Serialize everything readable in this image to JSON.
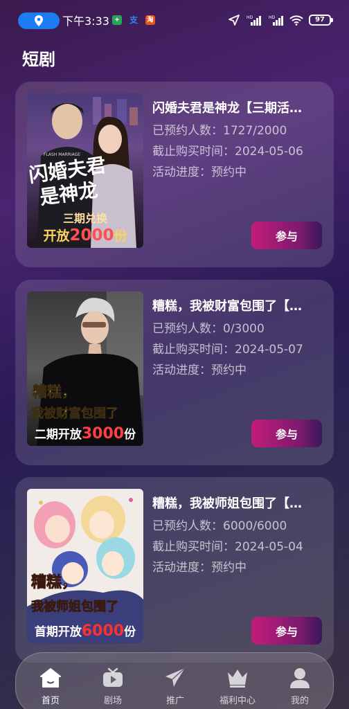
{
  "status_bar": {
    "time": "下午3:33",
    "app_icons": [
      "+",
      "支",
      "淘"
    ],
    "battery": "97",
    "network_labels": [
      "HD",
      "HD"
    ]
  },
  "page": {
    "title": "短剧"
  },
  "cards": [
    {
      "title": "闪婚夫君是神龙【三期活…",
      "reserved": "已预约人数：1727/2000",
      "deadline": "截止购买时间：2024-05-06",
      "progress": "活动进度：预约中",
      "button": "参与",
      "cover": {
        "title_line1": "闪婚夫君",
        "title_line2": "是神龙",
        "line1": "三期兑换",
        "line2_prefix": "开放",
        "line2_num": "2000",
        "line2_suffix": "份",
        "small_caption": "FLASH MARRIAGE"
      }
    },
    {
      "title": "糟糕，我被财富包围了【…",
      "reserved": "已预约人数：0/3000",
      "deadline": "截止购买时间：2024-05-07",
      "progress": "活动进度：预约中",
      "button": "参与",
      "cover": {
        "title_line1": "糟糕，",
        "title_line2": "我被财富包围了",
        "line1": "二期开放",
        "line2_num": "3000",
        "line2_suffix": "份"
      }
    },
    {
      "title": "糟糕，我被师姐包围了【…",
      "reserved": "已预约人数：6000/6000",
      "deadline": "截止购买时间：2024-05-04",
      "progress": "活动进度：预约中",
      "button": "参与",
      "cover": {
        "title_line1": "糟糕，",
        "title_line2": "我被师姐包围了",
        "line1": "首期开放",
        "line2_num": "6000",
        "line2_suffix": "份"
      }
    }
  ],
  "tabbar": {
    "items": [
      {
        "label": "首页",
        "icon": "home-icon",
        "active": true
      },
      {
        "label": "剧场",
        "icon": "theater-icon",
        "active": false
      },
      {
        "label": "推广",
        "icon": "send-icon",
        "active": false
      },
      {
        "label": "福利中心",
        "icon": "crown-icon",
        "active": false
      },
      {
        "label": "我的",
        "icon": "user-icon",
        "active": false
      }
    ]
  },
  "colors": {
    "accent_button": "#c41c7a",
    "location_pill": "#1d7cf2"
  }
}
